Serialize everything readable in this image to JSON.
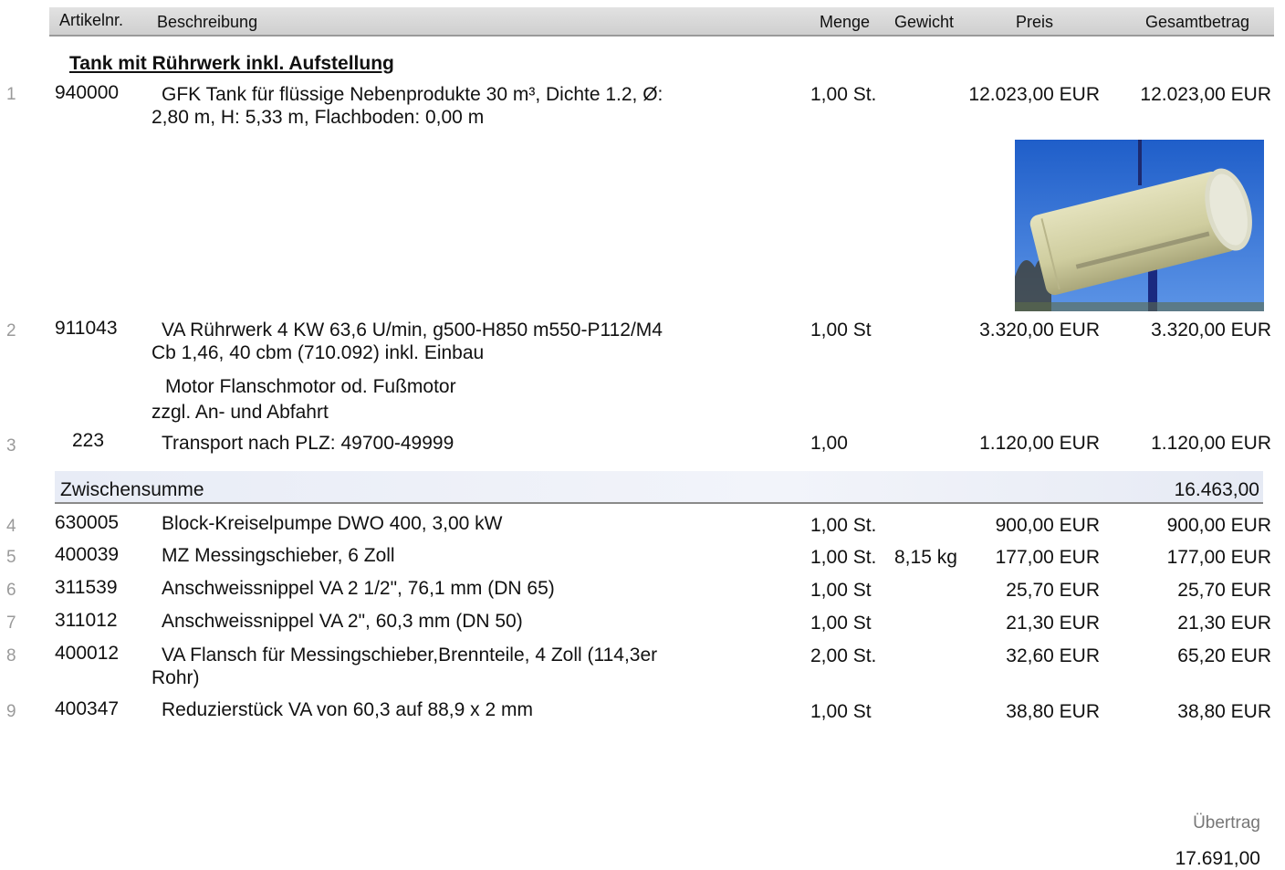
{
  "header": {
    "artikelnr": "Artikelnr.",
    "beschreibung": "Beschreibung",
    "menge": "Menge",
    "gewicht": "Gewicht",
    "preis": "Preis",
    "gesamtbetrag": "Gesamtbetrag"
  },
  "section_title": "Tank mit Rührwerk inkl. Aufstellung",
  "items": [
    {
      "pos": "1",
      "artnr": "940000",
      "desc_lines": [
        "GFK Tank für flüssige Nebenprodukte 30 m³, Dichte 1.2, Ø:",
        "2,80 m, H: 5,33 m, Flachboden: 0,00 m"
      ],
      "menge": "1,00 St.",
      "gewicht": "",
      "preis": "12.023,00 EUR",
      "gesamt": "12.023,00 EUR"
    },
    {
      "pos": "2",
      "artnr": "911043",
      "desc_lines": [
        "VA Rührwerk 4 KW 63,6 U/min, g500-H850 m550-P112/M4",
        "Cb 1,46, 40 cbm (710.092) inkl. Einbau"
      ],
      "menge": "1,00 St",
      "gewicht": "",
      "preis": "3.320,00 EUR",
      "gesamt": "3.320,00 EUR"
    },
    {
      "pos": "3",
      "artnr": "223",
      "desc_lines": [
        "Transport nach PLZ: 49700-49999"
      ],
      "menge": "1,00",
      "gewicht": "",
      "preis": "1.120,00 EUR",
      "gesamt": "1.120,00 EUR"
    },
    {
      "pos": "4",
      "artnr": "630005",
      "desc_lines": [
        "Block-Kreiselpumpe DWO 400, 3,00 kW"
      ],
      "menge": "1,00 St.",
      "gewicht": "",
      "preis": "900,00 EUR",
      "gesamt": "900,00 EUR"
    },
    {
      "pos": "5",
      "artnr": "400039",
      "desc_lines": [
        "MZ Messingschieber, 6 Zoll"
      ],
      "menge": "1,00 St.",
      "gewicht": "8,15 kg",
      "preis": "177,00 EUR",
      "gesamt": "177,00 EUR"
    },
    {
      "pos": "6",
      "artnr": "311539",
      "desc_lines": [
        "Anschweissnippel VA 2 1/2\", 76,1 mm (DN 65)"
      ],
      "menge": "1,00 St",
      "gewicht": "",
      "preis": "25,70 EUR",
      "gesamt": "25,70 EUR"
    },
    {
      "pos": "7",
      "artnr": "311012",
      "desc_lines": [
        "Anschweissnippel VA 2\", 60,3 mm (DN 50)"
      ],
      "menge": "1,00 St",
      "gewicht": "",
      "preis": "21,30 EUR",
      "gesamt": "21,30 EUR"
    },
    {
      "pos": "8",
      "artnr": "400012",
      "desc_lines": [
        "VA Flansch für Messingschieber,Brennteile, 4 Zoll (114,3er",
        "Rohr)"
      ],
      "menge": "2,00 St.",
      "gewicht": "",
      "preis": "32,60 EUR",
      "gesamt": "65,20 EUR"
    },
    {
      "pos": "9",
      "artnr": "400347",
      "desc_lines": [
        "Reduzierstück VA von 60,3 auf 88,9 x 2 mm"
      ],
      "menge": "1,00 St",
      "gewicht": "",
      "preis": "38,80 EUR",
      "gesamt": "38,80 EUR"
    }
  ],
  "notes": [
    "Motor Flanschmotor od. Fußmotor",
    "zzgl. An- und Abfahrt"
  ],
  "subtotal": {
    "label": "Zwischensumme",
    "value": "16.463,00"
  },
  "carry": {
    "label": "Übertrag",
    "value": "17.691,00"
  },
  "colors": {
    "header_bg": "#d8d8d8",
    "subtotal_bg": "#eef1f8",
    "pos_number": "#9a9a9a"
  }
}
